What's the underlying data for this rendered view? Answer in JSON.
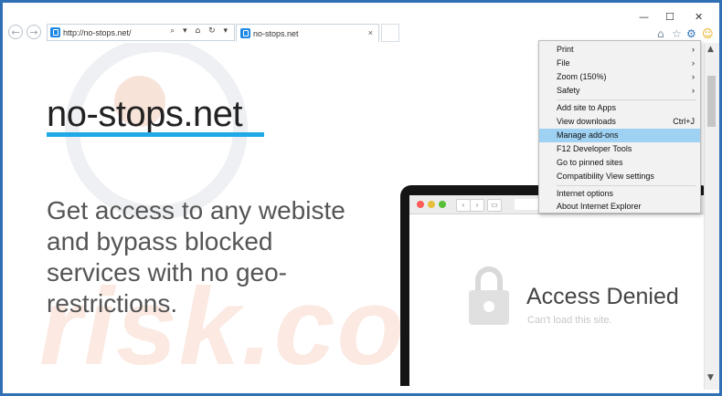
{
  "browser": {
    "address": "http://no-stops.net/",
    "tab_title": "no-stops.net",
    "tab_close": "×",
    "nav_back": "←",
    "nav_forward": "→",
    "address_icons": "⌕ ▾ ⌂ ↻ ▾",
    "controls": {
      "minimize": "—",
      "maximize": "☐",
      "close": "✕"
    },
    "toolbar": {
      "home": "⌂",
      "favorites": "☆",
      "tools": "⚙",
      "smiley": "☺"
    }
  },
  "page": {
    "site_title": "no-stops.net",
    "tagline": "Get access to any webiste and bypass blocked services with no geo-restrictions.",
    "watermark": "risk.com",
    "laptop": {
      "denied_title": "Access Denied",
      "denied_subtitle": "Can't load this site.",
      "nav_back": "‹",
      "nav_forward": "›",
      "sidebar_btn": "▭"
    }
  },
  "menu": {
    "items": [
      {
        "label": "Print",
        "right": "›"
      },
      {
        "label": "File",
        "right": "›"
      },
      {
        "label": "Zoom (150%)",
        "right": "›"
      },
      {
        "label": "Safety",
        "right": "›"
      },
      {
        "label": "Add site to Apps",
        "right": ""
      },
      {
        "label": "View downloads",
        "right": "Ctrl+J"
      },
      {
        "label": "Manage add-ons",
        "right": ""
      },
      {
        "label": "F12 Developer Tools",
        "right": ""
      },
      {
        "label": "Go to pinned sites",
        "right": ""
      },
      {
        "label": "Compatibility View settings",
        "right": ""
      },
      {
        "label": "Internet options",
        "right": ""
      },
      {
        "label": "About Internet Explorer",
        "right": ""
      }
    ],
    "highlighted_index": 6
  },
  "scroll": {
    "up": "▲",
    "down": "▼"
  },
  "colors": {
    "accent": "#1fa9e6",
    "menu_highlight": "#9fd1f2",
    "frame": "#2f6fb3"
  }
}
